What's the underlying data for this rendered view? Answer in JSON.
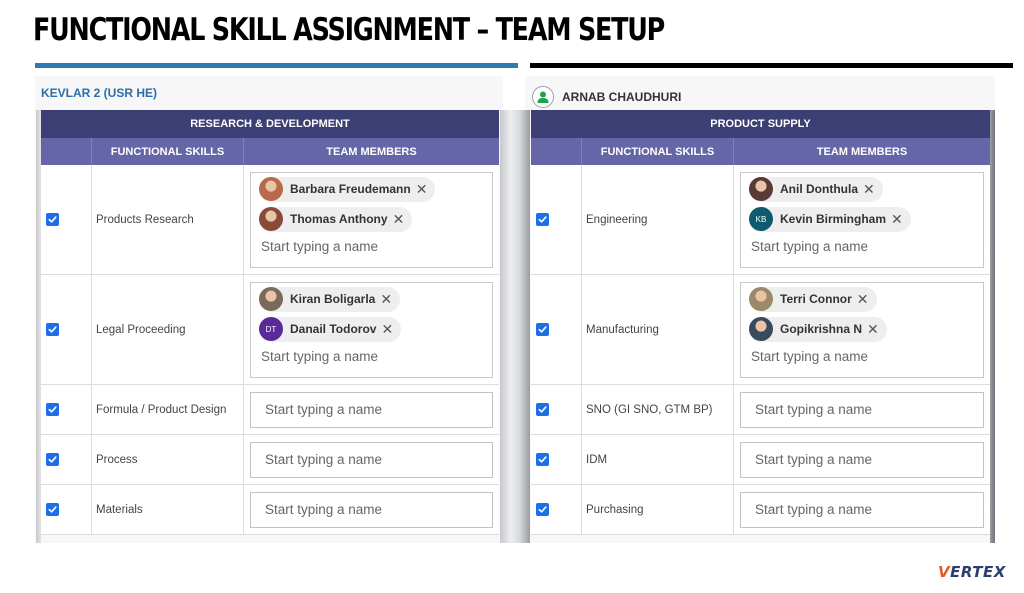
{
  "title": "FUNCTIONAL SKILL ASSIGNMENT – TEAM SETUP",
  "colors": {
    "left_bar": "#2d7bb0",
    "right_bar": "#000000",
    "group_header": "#3b3f73",
    "column_header": "#6466a8",
    "checkbox": "#1e6ee6",
    "user_icon": "#1fa34a"
  },
  "panels": [
    {
      "label": "KEVLAR 2 (USR HE)",
      "group": "RESEARCH & DEVELOPMENT",
      "columns": [
        "FUNCTIONAL SKILLS",
        "TEAM MEMBERS"
      ],
      "rows": [
        {
          "checked": true,
          "skill": "Products Research",
          "members": [
            {
              "name": "Barbara Freudemann",
              "avatar": "photo",
              "color": "#b86a4a"
            },
            {
              "name": "Thomas Anthony",
              "avatar": "photo",
              "color": "#8a4a3a"
            }
          ],
          "placeholder": "Start typing a name"
        },
        {
          "checked": true,
          "skill": "Legal Proceeding",
          "members": [
            {
              "name": "Kiran Boligarla",
              "avatar": "photo",
              "color": "#7a6a5a"
            },
            {
              "name": "Danail Todorov",
              "avatar": "initials",
              "initials": "DT",
              "color": "#5b2a9a"
            }
          ],
          "placeholder": "Start typing a name"
        },
        {
          "checked": true,
          "skill": "Formula / Product Design",
          "members": [],
          "placeholder": "Start typing a name"
        },
        {
          "checked": true,
          "skill": "Process",
          "members": [],
          "placeholder": "Start typing a name"
        },
        {
          "checked": true,
          "skill": "Materials",
          "members": [],
          "placeholder": "Start typing a name"
        }
      ]
    },
    {
      "label": "ARNAB CHAUDHURI",
      "group": "PRODUCT SUPPLY",
      "columns": [
        "FUNCTIONAL SKILLS",
        "TEAM MEMBERS"
      ],
      "rows": [
        {
          "checked": true,
          "skill": "Engineering",
          "members": [
            {
              "name": "Anil Donthula",
              "avatar": "photo",
              "color": "#5a3a34"
            },
            {
              "name": "Kevin Birmingham",
              "avatar": "initials",
              "initials": "KB",
              "color": "#0e5a6e"
            }
          ],
          "placeholder": "Start typing a name"
        },
        {
          "checked": true,
          "skill": "Manufacturing",
          "members": [
            {
              "name": "Terri Connor",
              "avatar": "photo",
              "color": "#9a8a6a"
            },
            {
              "name": "Gopikrishna N",
              "avatar": "photo",
              "color": "#3a4a5e"
            }
          ],
          "placeholder": "Start typing a name"
        },
        {
          "checked": true,
          "skill": "SNO (GI SNO, GTM BP)",
          "members": [],
          "placeholder": "Start typing a name"
        },
        {
          "checked": true,
          "skill": "IDM",
          "members": [],
          "placeholder": "Start typing a name"
        },
        {
          "checked": true,
          "skill": "Purchasing",
          "members": [],
          "placeholder": "Start typing a name"
        }
      ]
    }
  ],
  "logo": {
    "first": "V",
    "rest": "ERTEX"
  }
}
